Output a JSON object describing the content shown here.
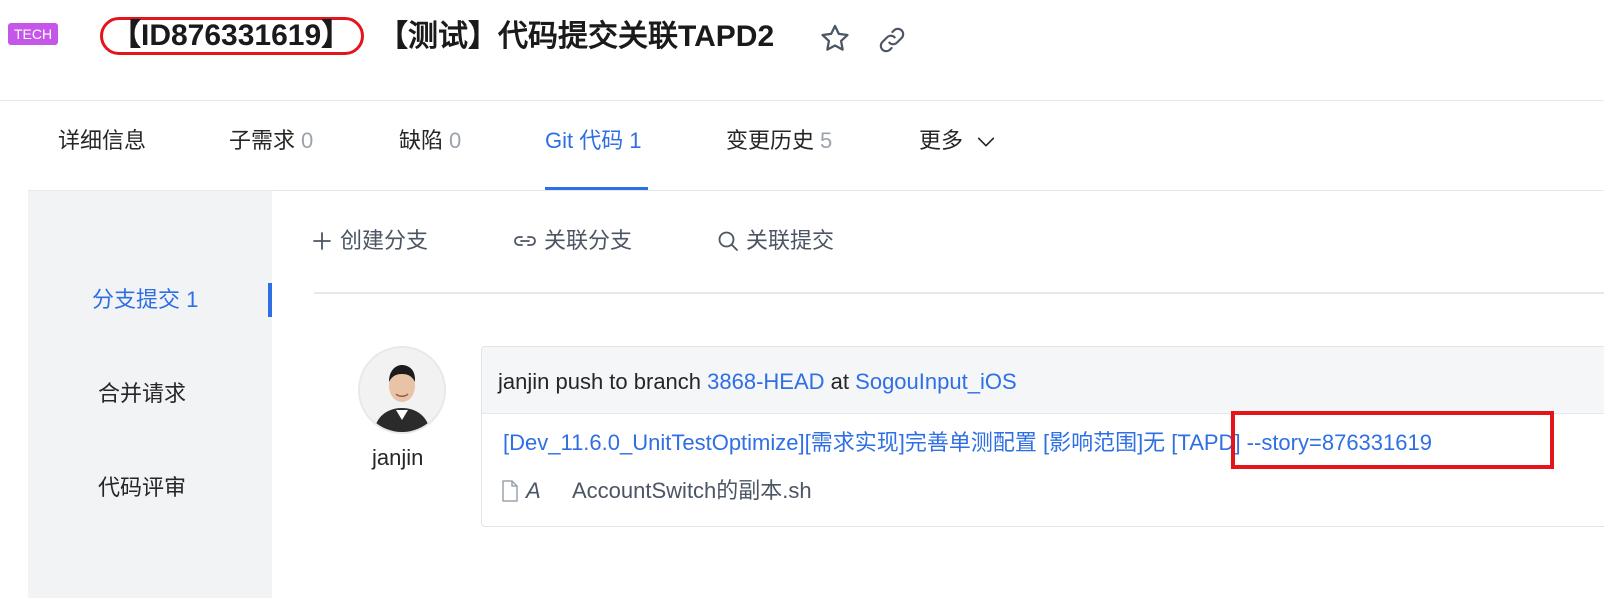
{
  "header": {
    "tag": "TECH",
    "id": "【ID876331619】",
    "title": "【测试】代码提交关联TAPD2",
    "icons": [
      "star-icon",
      "link-icon"
    ]
  },
  "tabs": [
    {
      "label": "详细信息",
      "count": ""
    },
    {
      "label": "子需求",
      "count": "0"
    },
    {
      "label": "缺陷",
      "count": "0"
    },
    {
      "label": "Git 代码",
      "count": "1",
      "active": true
    },
    {
      "label": "变更历史",
      "count": "5"
    },
    {
      "label": "更多",
      "count": ""
    }
  ],
  "sidebar": {
    "items": [
      {
        "label": "分支提交 1",
        "active": true
      },
      {
        "label": "合并请求"
      },
      {
        "label": "代码评审"
      }
    ]
  },
  "toolbar": {
    "create_branch": "创建分支",
    "link_branch": "关联分支",
    "link_commit": "关联提交"
  },
  "commit": {
    "author": "janjin",
    "push_prefix": "janjin push to branch",
    "branch": "3868-HEAD",
    "at": "at",
    "repo": "SogouInput_iOS",
    "message": "[Dev_11.6.0_UnitTestOptimize][需求实现]完善单测配置 [影响范围]无 [TAPD] --story=876331619",
    "file_status": "A",
    "file_name": "AccountSwitch的副本.sh"
  },
  "colors": {
    "accent": "#2f6fe4",
    "tag": "#c457e8",
    "annotation_red": "#e3151a"
  }
}
